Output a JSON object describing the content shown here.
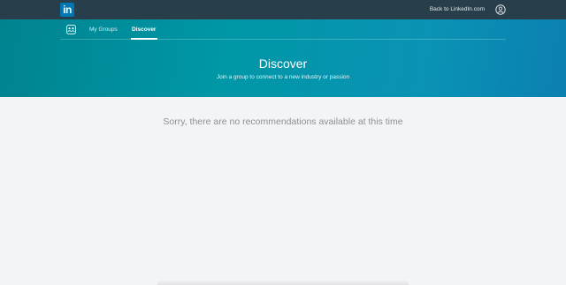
{
  "topbar": {
    "logo_text": "in",
    "back_link_label": "Back to LinkedIn.com",
    "profile_icon": "user-circle-icon"
  },
  "subnav": {
    "groups_icon": "groups-icon",
    "tabs": [
      {
        "label": "My Groups",
        "active": false
      },
      {
        "label": "Discover",
        "active": true
      }
    ]
  },
  "hero": {
    "title": "Discover",
    "subtitle": "Join a group to connect to a new industry or passion"
  },
  "main": {
    "empty_message": "Sorry, there are no recommendations available at this time"
  },
  "colors": {
    "topbar_bg": "#283e4a",
    "brand_blue": "#0077b5",
    "hero_teal": "#0097a7",
    "page_bg": "#f3f4f6"
  }
}
